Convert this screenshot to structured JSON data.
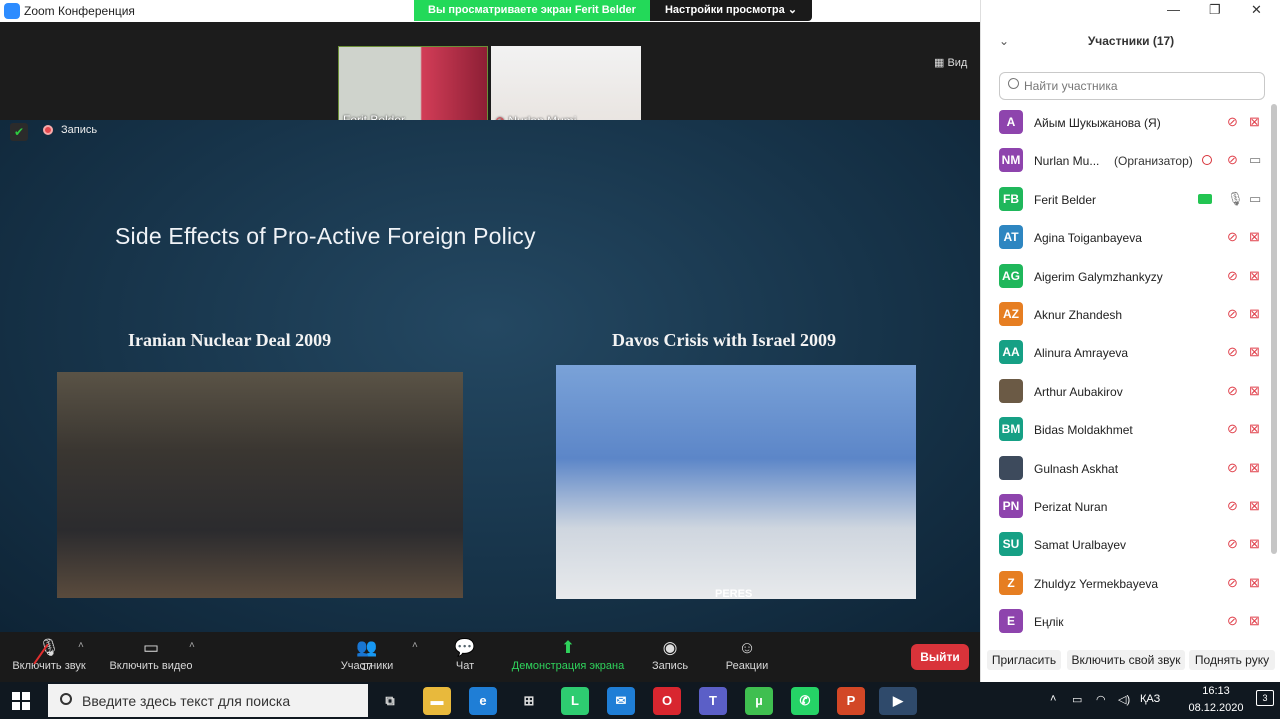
{
  "window": {
    "title": "Zoom Конференция",
    "controls": [
      "—",
      "❐",
      "✕"
    ]
  },
  "banner": {
    "share_text": "Вы просматриваете экран Ferit Belder",
    "view_options": "Настройки просмотра ⌄"
  },
  "thumbnails": [
    {
      "name": "Ferit Belder"
    },
    {
      "name": "Nurlan Mumi..."
    }
  ],
  "view_button": "Вид",
  "recording_label": "Запись",
  "slide": {
    "title": "Side Effects of Pro-Active Foreign Policy",
    "left_caption": "Iranian Nuclear Deal 2009",
    "right_caption": "Davos Crisis with Israel 2009",
    "nameplate": "PERES"
  },
  "toolbar": {
    "mic": "Включить звук",
    "video": "Включить видео",
    "participants": "Участники",
    "participants_count": "17",
    "chat": "Чат",
    "share": "Демонстрация экрана",
    "record": "Запись",
    "reactions": "Реакции",
    "leave": "Выйти"
  },
  "panel": {
    "title": "Участники (17)",
    "search_placeholder": "Найти участника",
    "participants": [
      {
        "initials": "A",
        "name": "Айым Шукыжанова (Я)",
        "role": "",
        "color": "#8e44ad",
        "mic_muted": true,
        "video_off": true
      },
      {
        "initials": "NM",
        "name": "Nurlan Mu...",
        "role": "(Организатор)",
        "color": "#8e44ad",
        "mic_muted": true,
        "video_off": false
      },
      {
        "initials": "FB",
        "name": "Ferit Belder",
        "role": "",
        "color": "#1fb75b",
        "mic_muted": false,
        "video_off": false
      },
      {
        "initials": "AT",
        "name": "Agina Toiganbayeva",
        "role": "",
        "color": "#2e86c1",
        "mic_muted": true,
        "video_off": true
      },
      {
        "initials": "AG",
        "name": "Aigerim Galymzhankyzy",
        "role": "",
        "color": "#1fb75b",
        "mic_muted": true,
        "video_off": true
      },
      {
        "initials": "AZ",
        "name": "Aknur Zhandesh",
        "role": "",
        "color": "#e67e22",
        "mic_muted": true,
        "video_off": true
      },
      {
        "initials": "AA",
        "name": "Alinura Amrayeva",
        "role": "",
        "color": "#16a085",
        "mic_muted": true,
        "video_off": true
      },
      {
        "initials": "",
        "name": "Arthur Aubakirov",
        "role": "",
        "color": "#6b5a45",
        "mic_muted": true,
        "video_off": true
      },
      {
        "initials": "BM",
        "name": "Bidas Moldakhmet",
        "role": "",
        "color": "#16a085",
        "mic_muted": true,
        "video_off": true
      },
      {
        "initials": "",
        "name": "Gulnash Askhat",
        "role": "",
        "color": "#3d4a5c",
        "mic_muted": true,
        "video_off": true
      },
      {
        "initials": "PN",
        "name": "Perizat Nuran",
        "role": "",
        "color": "#8e44ad",
        "mic_muted": true,
        "video_off": true
      },
      {
        "initials": "SU",
        "name": "Samat Uralbayev",
        "role": "",
        "color": "#16a085",
        "mic_muted": true,
        "video_off": true
      },
      {
        "initials": "Z",
        "name": "Zhuldyz Yermekbayeva",
        "role": "",
        "color": "#e67e22",
        "mic_muted": true,
        "video_off": true
      },
      {
        "initials": "E",
        "name": "Еңлік",
        "role": "",
        "color": "#8e44ad",
        "mic_muted": true,
        "video_off": true
      }
    ],
    "buttons": {
      "invite": "Пригласить",
      "unmute": "Включить свой звук",
      "raise_hand": "Поднять руку"
    }
  },
  "taskbar": {
    "search_placeholder": "Введите здесь текст для поиска",
    "language": "ҚАЗ",
    "time": "16:13",
    "date": "08.12.2020",
    "notifications": "3"
  }
}
